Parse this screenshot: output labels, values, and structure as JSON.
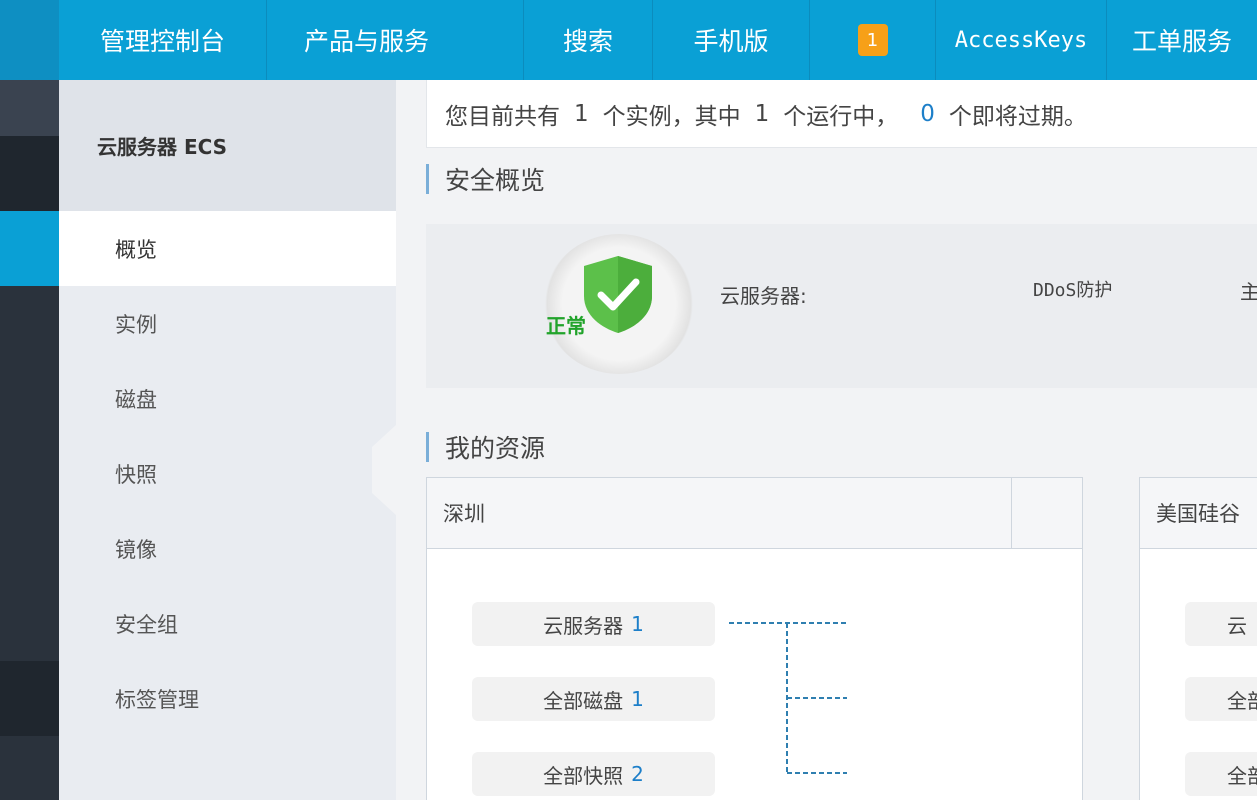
{
  "topbar": {
    "console": "管理控制台",
    "products": "产品与服务",
    "search": "搜索",
    "mobile": "手机版",
    "notification_count": "1",
    "access_keys": "AccessKeys",
    "tickets": "工单服务"
  },
  "sidebar": {
    "title": "云服务器 ECS",
    "items": [
      {
        "label": "概览",
        "active": true
      },
      {
        "label": "实例"
      },
      {
        "label": "磁盘"
      },
      {
        "label": "快照"
      },
      {
        "label": "镜像"
      },
      {
        "label": "安全组"
      },
      {
        "label": "标签管理"
      }
    ]
  },
  "summary": {
    "prefix": "您目前共有",
    "total": "1",
    "mid1": "个实例，其中",
    "running": "1",
    "mid2": "个运行中，",
    "expiring": "0",
    "suffix": "个即将过期。"
  },
  "security": {
    "title": "安全概览",
    "status": "正常",
    "server_label": "云服务器:",
    "ddos_label": "DDoS防护",
    "cut_label": "主"
  },
  "resources": {
    "title": "我的资源",
    "regions": [
      {
        "name": "深圳",
        "items": [
          {
            "label": "云服务器",
            "count": "1"
          },
          {
            "label": "全部磁盘",
            "count": "1"
          },
          {
            "label": "全部快照",
            "count": "2"
          }
        ]
      },
      {
        "name": "美国硅谷",
        "items": [
          {
            "label": "云"
          },
          {
            "label": "全部"
          },
          {
            "label": "全部"
          }
        ]
      }
    ]
  },
  "colors": {
    "topbar": "#0aa0d5",
    "rail": "#2a323c",
    "rail_active": "#0aa0d5",
    "link_blue": "#1d7fc9",
    "ok_green": "#21a32a",
    "badge": "#f7a018"
  }
}
